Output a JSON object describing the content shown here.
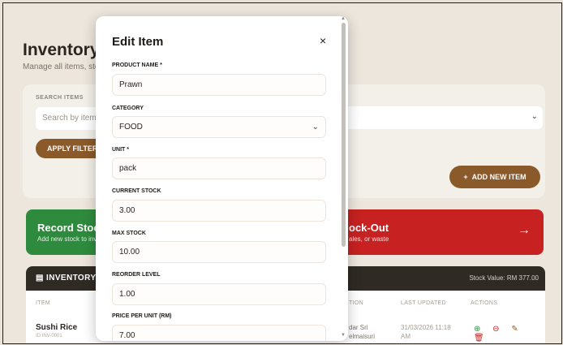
{
  "background": {
    "title": "Inventory",
    "subtitle": "Manage all items, sto",
    "search_label": "SEARCH ITEMS",
    "search_placeholder": "Search by item",
    "apply_filters": "APPLY FILTERS",
    "add_new_item": "ADD NEW ITEM",
    "record_title": "Record Stock",
    "record_sub": "Add new stock to inv",
    "stockout_title": "ock-Out",
    "stockout_sub": "ales, or waste",
    "table_title": "INVENTORY",
    "stock_value": "Stock Value: RM 377.00",
    "col_item": "ITEM",
    "col_location": "TION",
    "col_updated": "LAST UPDATED",
    "col_actions": "ACTIONS",
    "row_name": "Sushi Rice",
    "row_id": "ID:INV-0001",
    "row_loc_1": "dar Sri",
    "row_loc_2": "elmaisuri",
    "row_upd_1": "31/03/2026 11:18",
    "row_upd_2": "AM"
  },
  "modal": {
    "title": "Edit Item",
    "close": "×",
    "fields": [
      {
        "label": "PRODUCT NAME *",
        "value": "Prawn"
      },
      {
        "label": "CATEGORY",
        "value": "FOOD"
      },
      {
        "label": "UNIT *",
        "value": "pack"
      },
      {
        "label": "CURRENT STOCK",
        "value": "3.00"
      },
      {
        "label": "MAX STOCK",
        "value": "10.00"
      },
      {
        "label": "REORDER LEVEL",
        "value": "1.00"
      },
      {
        "label": "PRICE PER UNIT (RM)",
        "value": "7.00"
      }
    ]
  },
  "colors": {
    "brown": "#8a5a2b",
    "green": "#2e8b3d",
    "red": "#c72121",
    "dark": "#2f2a24"
  }
}
